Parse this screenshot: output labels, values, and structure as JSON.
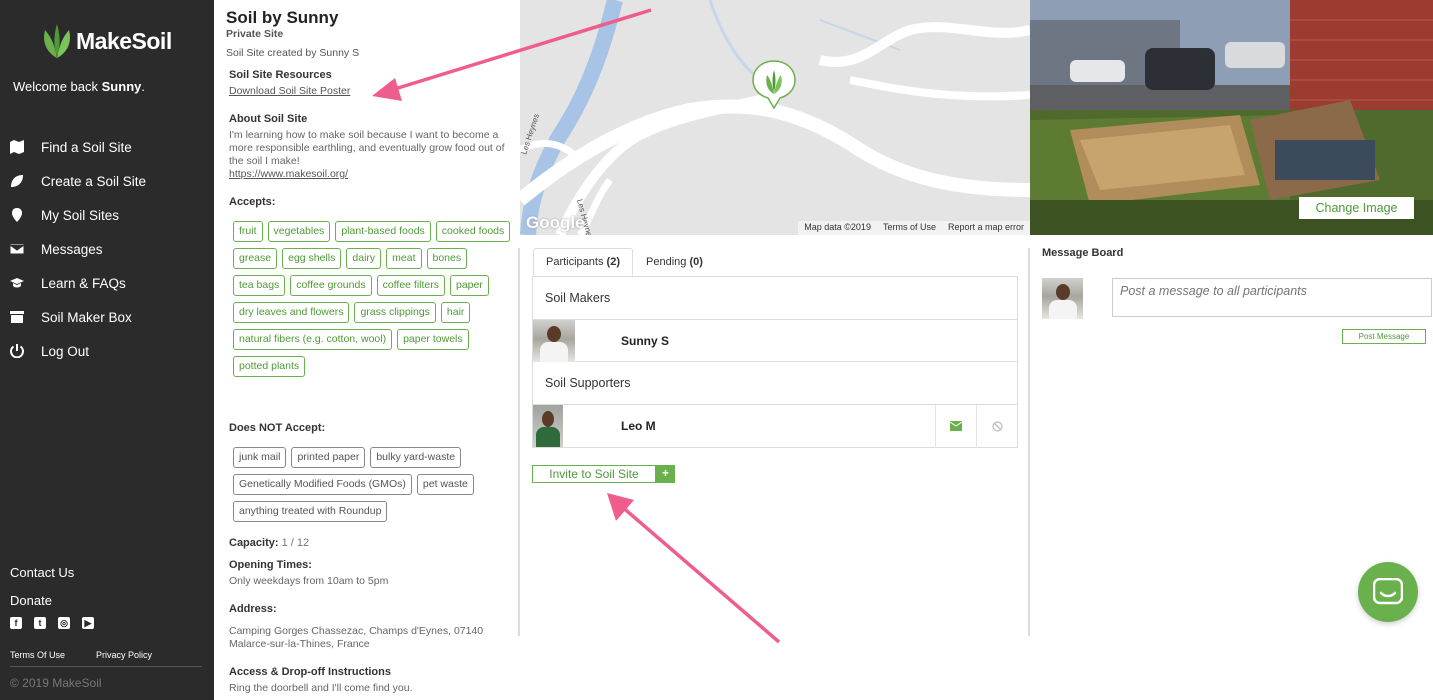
{
  "sidebar": {
    "brand": "MakeSoil",
    "welcome_prefix": "Welcome back ",
    "welcome_name": "Sunny",
    "welcome_suffix": ".",
    "nav": [
      {
        "label": "Find a Soil Site",
        "icon": "map-icon"
      },
      {
        "label": "Create a Soil Site",
        "icon": "leaf-icon"
      },
      {
        "label": "My Soil Sites",
        "icon": "map-pin-icon"
      },
      {
        "label": "Messages",
        "icon": "envelope-icon"
      },
      {
        "label": "Learn & FAQs",
        "icon": "graduation-cap-icon"
      },
      {
        "label": "Soil Maker Box",
        "icon": "box-icon"
      },
      {
        "label": "Log Out",
        "icon": "power-icon"
      }
    ],
    "contact": "Contact Us",
    "donate": "Donate",
    "socials": [
      "facebook-icon",
      "twitter-icon",
      "instagram-icon",
      "youtube-icon"
    ],
    "terms": "Terms Of Use",
    "privacy": "Privacy Policy",
    "copyright": "© 2019 MakeSoil"
  },
  "site": {
    "title": "Soil by Sunny",
    "type": "Private Site",
    "created": "Soil Site created by Sunny S",
    "resources_label": "Soil Site Resources",
    "poster_link": "Download Soil Site Poster",
    "about_label": "About Soil Site",
    "about_text": "I'm learning how to make soil because I want to become a more responsible earthling, and eventually grow food out of the soil I make!",
    "about_link": "https://www.makesoil.org/",
    "accepts_label": "Accepts:",
    "accepts": [
      "fruit",
      "vegetables",
      "plant-based foods",
      "cooked foods",
      "grease",
      "egg shells",
      "dairy",
      "meat",
      "bones",
      "tea bags",
      "coffee grounds",
      "coffee filters",
      "paper",
      "dry leaves and flowers",
      "grass clippings",
      "hair",
      "natural fibers (e.g. cotton, wool)",
      "paper towels",
      "potted plants"
    ],
    "not_accepts_label": "Does NOT Accept:",
    "not_accepts": [
      "junk mail",
      "printed paper",
      "bulky yard-waste",
      "Genetically Modified Foods (GMOs)",
      "pet waste",
      "anything treated with Roundup"
    ],
    "capacity_label": "Capacity:",
    "capacity_value": "1 / 12",
    "opening_label": "Opening Times:",
    "opening_value": "Only weekdays from 10am to 5pm",
    "address_label": "Address:",
    "address_value": "Camping Gorges Chassezac, Champs d'Eynes, 07140 Malarce-sur-la-Thines, France",
    "access_label": "Access & Drop-off Instructions",
    "access_value": "Ring the doorbell and I'll come find you."
  },
  "map": {
    "data": "Map data ©2019",
    "terms": "Terms of Use",
    "report": "Report a map error",
    "google": "Google",
    "road1": "Les Heynes",
    "road2": "Les Heynes"
  },
  "photo": {
    "change_image": "Change Image"
  },
  "participants": {
    "tabs": [
      {
        "label": "Participants",
        "count": "(2)"
      },
      {
        "label": "Pending",
        "count": "(0)"
      }
    ],
    "makers_label": "Soil Makers",
    "maker_name": "Sunny S",
    "supporters_label": "Soil Supporters",
    "supporter_name": "Leo M",
    "invite_label": "Invite to Soil Site",
    "invite_plus": "+"
  },
  "message_board": {
    "title": "Message Board",
    "placeholder": "Post a message to all participants",
    "post_label": "Post Message"
  },
  "colors": {
    "accent": "#6ab04c",
    "sidebar": "#2b2b2b",
    "annotation_arrow": "#ee5d8c"
  }
}
